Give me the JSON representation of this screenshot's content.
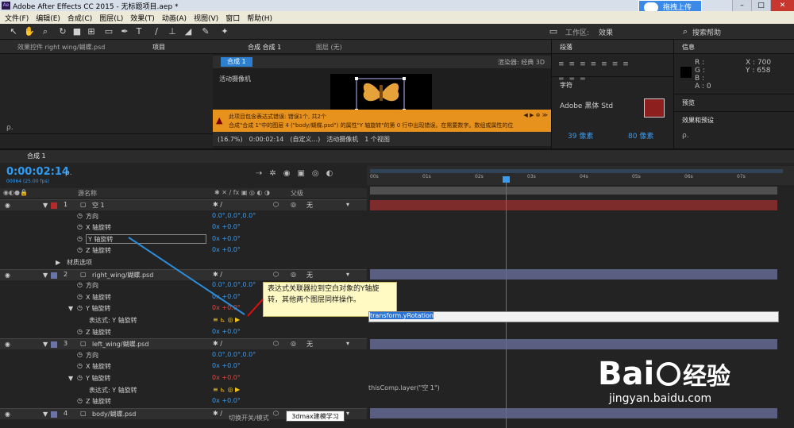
{
  "window": {
    "title": "Adobe After Effects CC 2015 - 无标题项目.aep *",
    "ae_icon": "Ae",
    "upload_btn": "拖拽上传"
  },
  "menu": [
    "文件(F)",
    "编辑(E)",
    "合成(C)",
    "图层(L)",
    "效果(T)",
    "动画(A)",
    "视图(V)",
    "窗口",
    "帮助(H)"
  ],
  "toolbar": {
    "workspace_label": "工作区:",
    "workspace": "效果",
    "search_help": "搜索帮助"
  },
  "project_panel": {
    "tab_effects": "效果控件 right wing/蝴蝶.psd",
    "tab_project": "项目",
    "search": "ρ."
  },
  "viewer": {
    "tab_comp": "合成 合成 1",
    "tab_layer": "图层 (无)",
    "comp_chip": "合成 1",
    "renderer": "渲染器: 经典 3D",
    "camera_label": "活动摄像机",
    "error_line1": "此项目包含表达式错误: 错误1个, 共2个",
    "error_line2": "合成\"合成 1\"中的图层 4 (\"body/蝴蝶.psd\") 的属性\"Y 轴旋转\"的第 0 行中出现错误。在需要数字。数组或属性的位",
    "zoom": "(16.7%)",
    "time": "0:00:02:14",
    "resolution": "(自定义...)",
    "camera": "活动摄像机",
    "views": "1 个视图"
  },
  "right_panels": {
    "align": "段落",
    "character": "字符",
    "font": "Adobe 黑体 Std",
    "size": "39 像素",
    "leading": "80 像素"
  },
  "info": {
    "title": "信息",
    "r": "R :",
    "g": "G :",
    "b": "B :",
    "a": "A : 0",
    "x": "X : 700",
    "y": "Y : 658",
    "preview": "预览",
    "effects": "效果和预设",
    "search": "ρ."
  },
  "timeline": {
    "tab": "合成 1",
    "timecode": "0:00:02:14",
    "fps": "00064 (25.00 fps)",
    "search": "ρ.",
    "col_source": "源名称",
    "col_parent": "父级",
    "ruler": [
      "00s",
      "01s",
      "02s",
      "03s",
      "04s",
      "05s",
      "06s",
      "07s"
    ],
    "rows": [
      {
        "kind": "layer",
        "num": "1",
        "name": "空 1",
        "color": "#b52b2b",
        "parent": "无"
      },
      {
        "kind": "prop",
        "name": "方向",
        "value": "0.0°,0.0°,0.0°"
      },
      {
        "kind": "prop",
        "name": "X 轴旋转",
        "value": "0x +0.0°"
      },
      {
        "kind": "prop",
        "name": "Y 轴旋转",
        "value": "0x +0.0°",
        "boxed": true
      },
      {
        "kind": "prop",
        "name": "Z 轴旋转",
        "value": "0x +0.0°"
      },
      {
        "kind": "group",
        "name": "材质选项"
      },
      {
        "kind": "layer",
        "num": "2",
        "name": "right_wing/蝴蝶.psd",
        "color": "#6a74a6",
        "parent": "无"
      },
      {
        "kind": "prop",
        "name": "方向",
        "value": "0.0°,0.0°,0.0°"
      },
      {
        "kind": "prop",
        "name": "X 轴旋转",
        "value": "0x +0.0°"
      },
      {
        "kind": "prop",
        "name": "Y 轴旋转",
        "value": "0x +0.0°",
        "red": true
      },
      {
        "kind": "expr",
        "name": "表达式: Y 轴旋转"
      },
      {
        "kind": "prop",
        "name": "Z 轴旋转",
        "value": "0x +0.0°"
      },
      {
        "kind": "layer",
        "num": "3",
        "name": "left_wing/蝴蝶.psd",
        "color": "#6a74a6",
        "parent": "无"
      },
      {
        "kind": "prop",
        "name": "方向",
        "value": "0.0°,0.0°,0.0°"
      },
      {
        "kind": "prop",
        "name": "X 轴旋转",
        "value": "0x +0.0°"
      },
      {
        "kind": "prop",
        "name": "Y 轴旋转",
        "value": "0x +0.0°",
        "red": true
      },
      {
        "kind": "expr",
        "name": "表达式: Y 轴旋转"
      },
      {
        "kind": "prop",
        "name": "Z 轴旋转",
        "value": "0x +0.0°"
      },
      {
        "kind": "layer",
        "num": "4",
        "name": "body/蝴蝶.psd",
        "color": "#6a74a6",
        "parent": "无"
      }
    ],
    "annotation": "表达式关联器拉到空白对象的Y轴旋转，其他两个图层同样操作。",
    "expr_text": "transform.yRotation",
    "expr_text2": "thisComp.layer(\"空 1\")",
    "switch_mode": "切换开关/模式",
    "tooltip": "3dmax建模学习"
  },
  "watermark": {
    "brand": "Bai",
    "brand2": "经验",
    "url": "jingyan.baidu.com"
  }
}
